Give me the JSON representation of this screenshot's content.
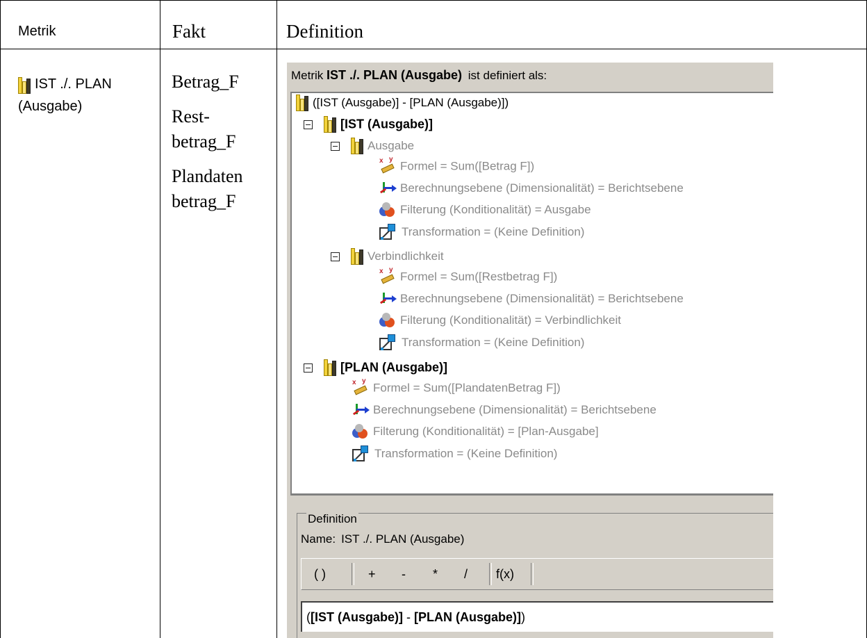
{
  "table": {
    "headers": {
      "metrik": "Metrik",
      "fakt": "Fakt",
      "definition": "Definition"
    },
    "metric_line1": "IST ./. PLAN",
    "metric_line2": "(Ausgabe)",
    "fakten": [
      "Betrag_F",
      "Rest-",
      "betrag_F",
      "Plandaten",
      "betrag_F"
    ]
  },
  "dialog": {
    "title_prefix": "Metrik",
    "title_name": "IST ./. PLAN (Ausgabe)",
    "title_suffix": "ist definiert als:",
    "tree": {
      "root": "([IST (Ausgabe)] - [PLAN (Ausgabe)])",
      "ist": "[IST (Ausgabe)]",
      "ausgabe": "Ausgabe",
      "ausgabe_formel": "Formel = Sum([Betrag F])",
      "ausgabe_dim": "Berechnungsebene (Dimensionalität) = Berichtsebene",
      "ausgabe_filter": "Filterung (Konditionalität) = Ausgabe",
      "ausgabe_trans": "Transformation = (Keine Definition)",
      "verbind": "Verbindlichkeit",
      "verbind_formel": "Formel = Sum([Restbetrag F])",
      "verbind_dim": "Berechnungsebene (Dimensionalität) = Berichtsebene",
      "verbind_filter": "Filterung (Konditionalität) = Verbindlichkeit",
      "verbind_trans": "Transformation = (Keine Definition)",
      "plan": "[PLAN (Ausgabe)]",
      "plan_formel": "Formel = Sum([PlandatenBetrag F])",
      "plan_dim": "Berechnungsebene (Dimensionalität) = Berichtsebene",
      "plan_filter": "Filterung (Konditionalität) = [Plan-Ausgabe]",
      "plan_trans": "Transformation = (Keine Definition)"
    },
    "definition": {
      "legend": "Definition",
      "name_label": "Name:",
      "name_value": "IST ./. PLAN (Ausgabe)",
      "toolbar": {
        "paren": "( )",
        "plus": "+",
        "minus": "-",
        "times": "*",
        "divide": "/",
        "func": "f(x)"
      },
      "formula_open": "(",
      "formula_ist": "[IST (Ausgabe)]",
      "formula_op": " - ",
      "formula_plan": "[PLAN (Ausgabe)]",
      "formula_close": ")"
    }
  }
}
